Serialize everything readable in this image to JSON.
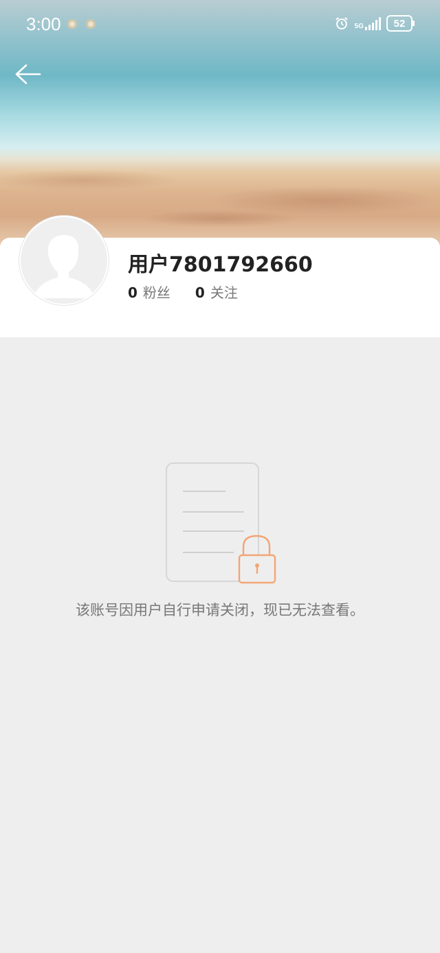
{
  "status_bar": {
    "time": "3:00",
    "network": "5G",
    "battery": "52"
  },
  "profile": {
    "username": "用户7801792660",
    "followers_count": "0",
    "followers_label": "粉丝",
    "following_count": "0",
    "following_label": "关注"
  },
  "empty_state": {
    "message": "该账号因用户自行申请关闭，现已无法查看。"
  },
  "icons": {
    "back": "arrow-left-icon",
    "lock": "lock-icon",
    "document": "document-icon",
    "avatar": "default-avatar-icon",
    "alarm": "alarm-icon"
  },
  "colors": {
    "lock_accent": "#f2a574",
    "background": "#eeeeee"
  }
}
